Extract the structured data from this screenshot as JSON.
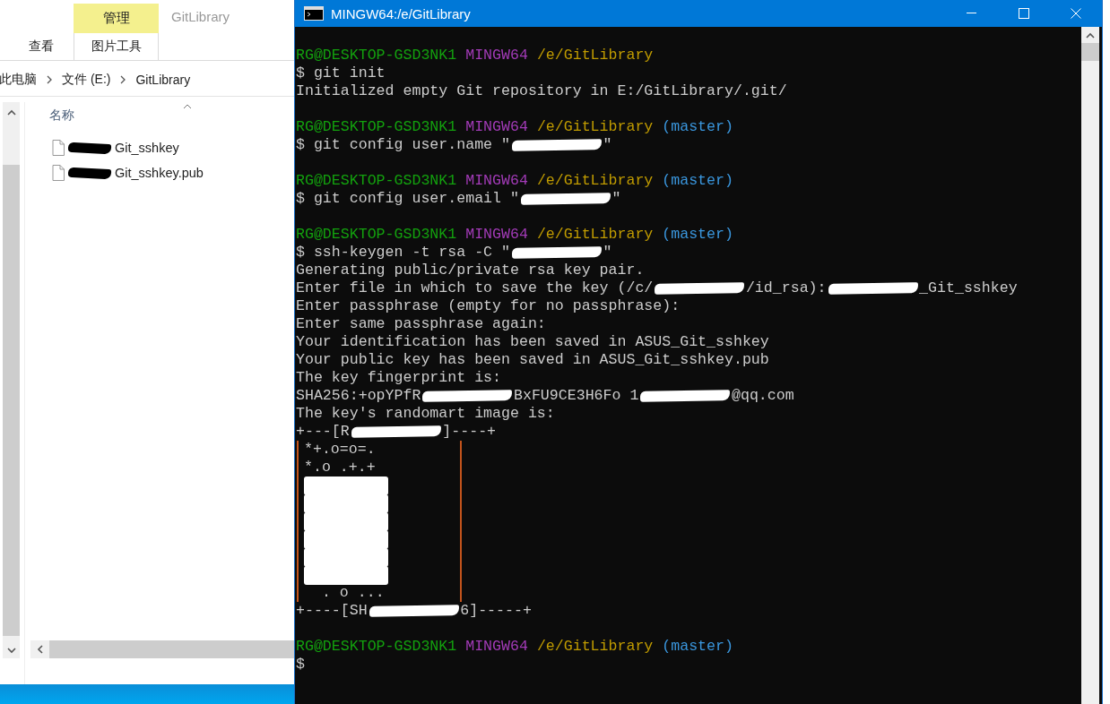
{
  "explorer": {
    "context_tab": {
      "label": "管理"
    },
    "window_title": "GitLibrary",
    "tabs": [
      {
        "label": "查看"
      },
      {
        "label": "图片工具"
      }
    ],
    "breadcrumb": [
      "此电脑",
      "文件 (E:)",
      "GitLibrary"
    ],
    "column_header": "名称",
    "files": [
      {
        "name": "Git_sshkey",
        "redacted_prefix": true
      },
      {
        "name": "Git_sshkey.pub",
        "redacted_prefix": true
      }
    ]
  },
  "terminal": {
    "title": "MINGW64:/e/GitLibrary",
    "lines": [
      {
        "kind": "prompt",
        "user": "RG@DESKTOP-GSD3NK1",
        "shell": "MINGW64",
        "path": "/e/GitLibrary"
      },
      {
        "kind": "output",
        "segments": [
          {
            "kind": "plain",
            "text": "$ git init"
          }
        ]
      },
      {
        "kind": "output",
        "segments": [
          {
            "kind": "plain",
            "text": "Initialized empty Git repository in E:/GitLibrary/.git/"
          }
        ]
      },
      {
        "kind": "blank"
      },
      {
        "kind": "prompt",
        "user": "RG@DESKTOP-GSD3NK1",
        "shell": "MINGW64",
        "path": "/e/GitLibrary",
        "branch": "(master)"
      },
      {
        "kind": "output",
        "segments": [
          {
            "kind": "plain",
            "text": "$ git config user.name \""
          },
          {
            "kind": "redaction"
          },
          {
            "kind": "plain",
            "text": "\""
          }
        ]
      },
      {
        "kind": "blank"
      },
      {
        "kind": "prompt",
        "user": "RG@DESKTOP-GSD3NK1",
        "shell": "MINGW64",
        "path": "/e/GitLibrary",
        "branch": "(master)"
      },
      {
        "kind": "output",
        "segments": [
          {
            "kind": "plain",
            "text": "$ git config user.email \""
          },
          {
            "kind": "redaction"
          },
          {
            "kind": "plain",
            "text": "\""
          }
        ]
      },
      {
        "kind": "blank"
      },
      {
        "kind": "prompt",
        "user": "RG@DESKTOP-GSD3NK1",
        "shell": "MINGW64",
        "path": "/e/GitLibrary",
        "branch": "(master)"
      },
      {
        "kind": "output",
        "segments": [
          {
            "kind": "plain",
            "text": "$ ssh-keygen -t rsa -C \""
          },
          {
            "kind": "redaction"
          },
          {
            "kind": "plain",
            "text": "\""
          }
        ]
      },
      {
        "kind": "output",
        "segments": [
          {
            "kind": "plain",
            "text": "Generating public/private rsa key pair."
          }
        ]
      },
      {
        "kind": "output",
        "segments": [
          {
            "kind": "plain",
            "text": "Enter file in which to save the key (/c/"
          },
          {
            "kind": "redaction"
          },
          {
            "kind": "plain",
            "text": "/id_rsa):"
          },
          {
            "kind": "redaction"
          },
          {
            "kind": "plain",
            "text": "_Git_sshkey"
          }
        ]
      },
      {
        "kind": "output",
        "segments": [
          {
            "kind": "plain",
            "text": "Enter passphrase (empty for no passphrase):"
          }
        ]
      },
      {
        "kind": "output",
        "segments": [
          {
            "kind": "plain",
            "text": "Enter same passphrase again:"
          }
        ]
      },
      {
        "kind": "output",
        "segments": [
          {
            "kind": "plain",
            "text": "Your identification has been saved in ASUS_Git_sshkey"
          }
        ]
      },
      {
        "kind": "output",
        "segments": [
          {
            "kind": "plain",
            "text": "Your public key has been saved in ASUS_Git_sshkey.pub"
          }
        ]
      },
      {
        "kind": "output",
        "segments": [
          {
            "kind": "plain",
            "text": "The key fingerprint is:"
          }
        ]
      },
      {
        "kind": "output",
        "segments": [
          {
            "kind": "plain",
            "text": "SHA256:+opYPfR"
          },
          {
            "kind": "redaction"
          },
          {
            "kind": "plain",
            "text": "BxFU9CE3H6Fo 1"
          },
          {
            "kind": "redaction"
          },
          {
            "kind": "plain",
            "text": "@qq.com"
          }
        ]
      },
      {
        "kind": "output",
        "segments": [
          {
            "kind": "plain",
            "text": "The key's randomart image is:"
          }
        ]
      },
      {
        "kind": "output",
        "segments": [
          {
            "kind": "plain",
            "text": "+---[R"
          },
          {
            "kind": "redaction"
          },
          {
            "kind": "plain",
            "text": "]----+"
          }
        ]
      },
      {
        "kind": "art",
        "rows": [
          {
            "text": "*+.o=o=."
          },
          {
            "text": "*.o .+.+"
          },
          {
            "hidden": true
          },
          {
            "hidden": true
          },
          {
            "hidden": true
          },
          {
            "hidden": true
          },
          {
            "hidden": true
          },
          {
            "hidden": true
          },
          {
            "text": "  . o ..."
          }
        ]
      },
      {
        "kind": "output",
        "segments": [
          {
            "kind": "plain",
            "text": "+----[SH"
          },
          {
            "kind": "redaction"
          },
          {
            "kind": "plain",
            "text": "6]-----+"
          }
        ]
      },
      {
        "kind": "blank"
      },
      {
        "kind": "prompt",
        "user": "RG@DESKTOP-GSD3NK1",
        "shell": "MINGW64",
        "path": "/e/GitLibrary",
        "branch": "(master)"
      },
      {
        "kind": "output",
        "segments": [
          {
            "kind": "plain",
            "text": "$"
          }
        ]
      }
    ]
  }
}
